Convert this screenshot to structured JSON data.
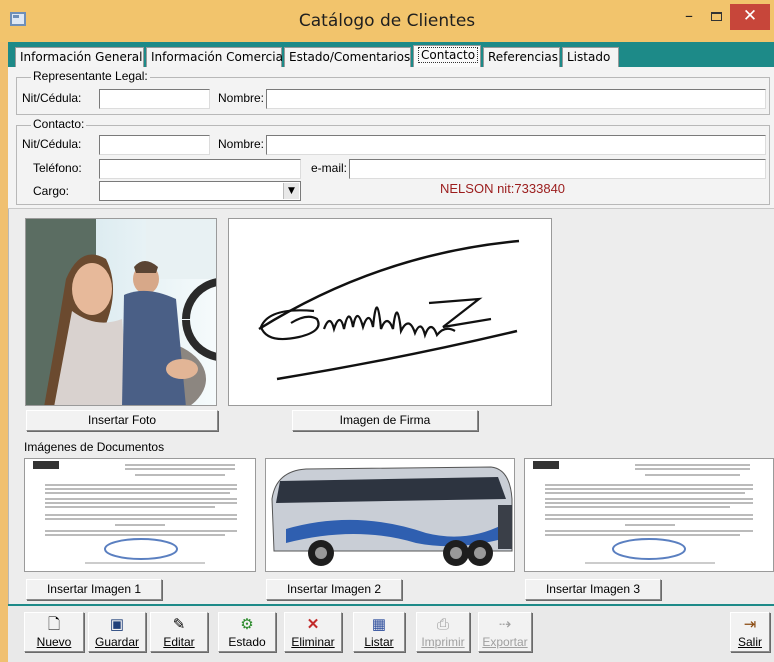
{
  "window": {
    "title": "Catálogo de Clientes",
    "min_glyph": "–",
    "close_glyph": "✕"
  },
  "tabs": [
    {
      "label": "Información General"
    },
    {
      "label": "Información Comercial"
    },
    {
      "label": "Estado/Comentarios"
    },
    {
      "label": "Contacto",
      "active": true
    },
    {
      "label": "Referencias"
    },
    {
      "label": "Listado"
    }
  ],
  "legal_rep": {
    "legend": "Representante Legal:",
    "id_label": "Nit/Cédula:",
    "id_value": "",
    "name_label": "Nombre:",
    "name_value": ""
  },
  "contact": {
    "legend": "Contacto:",
    "id_label": "Nit/Cédula:",
    "id_value": "",
    "name_label": "Nombre:",
    "name_value": "",
    "phone_label": "Teléfono:",
    "phone_value": "",
    "email_label": "e-mail:",
    "email_value": "",
    "role_label": "Cargo:",
    "role_value": "",
    "client_note": "NELSON nit:7333840"
  },
  "images": {
    "insert_photo": "Insertar Foto",
    "signature": "Imagen de Firma",
    "documents_label": "Imágenes de Documentos",
    "insert_image_1": "Insertar Imagen 1",
    "insert_image_2": "Insertar Imagen 2",
    "insert_image_3": "Insertar Imagen 3"
  },
  "toolbar": {
    "new": "Nuevo",
    "save": "Guardar",
    "edit": "Editar",
    "status": "Estado",
    "delete": "Eliminar",
    "list": "Listar",
    "print": "Imprimir",
    "export": "Exportar",
    "exit": "Salir"
  },
  "colors": {
    "title_bar": "#f2c46c",
    "tab_strip": "#1d8a88",
    "note_text": "#9b1c1c",
    "close_button": "#c7463a"
  }
}
